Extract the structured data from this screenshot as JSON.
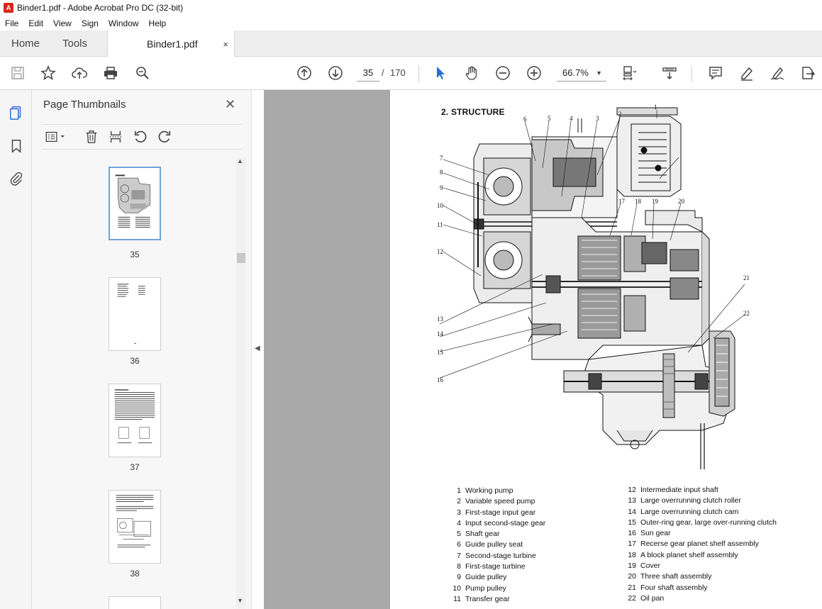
{
  "window": {
    "title": "Binder1.pdf - Adobe Acrobat Pro DC (32-bit)"
  },
  "menu": [
    "File",
    "Edit",
    "View",
    "Sign",
    "Window",
    "Help"
  ],
  "tabs": {
    "home": "Home",
    "tools": "Tools",
    "document": "Binder1.pdf",
    "close": "×"
  },
  "toolbar": {
    "current_page": "35",
    "separator": "/",
    "total_pages": "170",
    "zoom": "66.7%"
  },
  "panel": {
    "title": "Page Thumbnails",
    "close": "✕",
    "thumbnails": [
      "35",
      "36",
      "37",
      "38"
    ]
  },
  "page": {
    "heading": "2. STRUCTURE",
    "callouts": [
      "1",
      "2",
      "3",
      "4",
      "5",
      "6",
      "7",
      "8",
      "9",
      "10",
      "11",
      "12",
      "13",
      "14",
      "15",
      "16",
      "17",
      "18",
      "19",
      "20",
      "21",
      "22"
    ],
    "legend_left": [
      {
        "n": "1",
        "label": "Working pump"
      },
      {
        "n": "2",
        "label": "Variable speed pump"
      },
      {
        "n": "3",
        "label": "First-stage input gear"
      },
      {
        "n": "4",
        "label": "Input second-stage gear"
      },
      {
        "n": "5",
        "label": "Shaft gear"
      },
      {
        "n": "6",
        "label": "Guide pulley seat"
      },
      {
        "n": "7",
        "label": "Second-stage turbine"
      },
      {
        "n": "8",
        "label": "First-stage turbine"
      },
      {
        "n": "9",
        "label": "Guide pulley"
      },
      {
        "n": "10",
        "label": "Pump pulley"
      },
      {
        "n": "11",
        "label": "Transfer gear"
      }
    ],
    "legend_right": [
      {
        "n": "12",
        "label": "Intermediate input shaft"
      },
      {
        "n": "13",
        "label": "Large overrunning clutch roller"
      },
      {
        "n": "14",
        "label": "Large overrunning clutch cam"
      },
      {
        "n": "15",
        "label": "Outer-ring gear, large over-running clutch"
      },
      {
        "n": "16",
        "label": "Sun gear"
      },
      {
        "n": "17",
        "label": "Recerse gear planet shelf assembly"
      },
      {
        "n": "18",
        "label": "A block planet shelf assembly"
      },
      {
        "n": "19",
        "label": "Cover"
      },
      {
        "n": "20",
        "label": "Three shaft assembly"
      },
      {
        "n": "21",
        "label": "Four shaft assembly"
      },
      {
        "n": "22",
        "label": "Oil pan"
      }
    ]
  }
}
